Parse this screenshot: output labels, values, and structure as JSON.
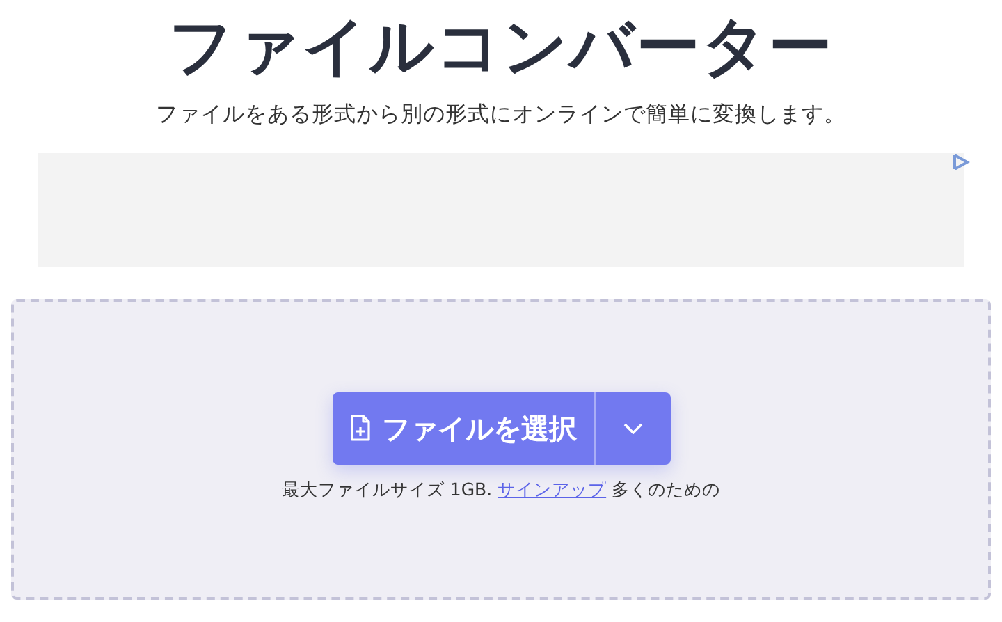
{
  "title": "ファイルコンバーター",
  "subtitle": "ファイルをある形式から別の形式にオンラインで簡単に変換します。",
  "ad": {
    "kind": "ad"
  },
  "upload": {
    "button": "ファイルを選択",
    "note_before": "最大ファイルサイズ 1GB.",
    "note_link": "サインアップ",
    "note_after": "多くのための"
  }
}
